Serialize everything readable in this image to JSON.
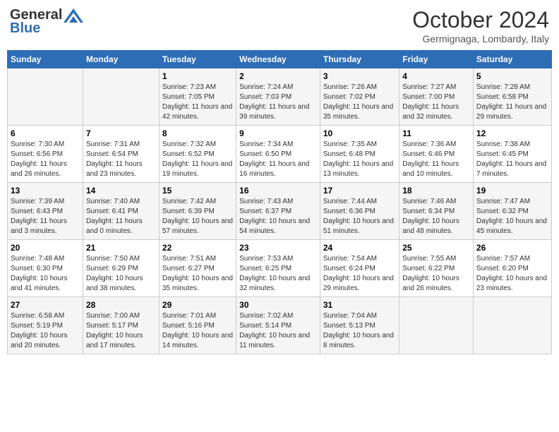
{
  "header": {
    "logo_line1": "General",
    "logo_line2": "Blue",
    "month": "October 2024",
    "location": "Germignaga, Lombardy, Italy"
  },
  "days_of_week": [
    "Sunday",
    "Monday",
    "Tuesday",
    "Wednesday",
    "Thursday",
    "Friday",
    "Saturday"
  ],
  "weeks": [
    [
      {
        "day": "",
        "info": ""
      },
      {
        "day": "",
        "info": ""
      },
      {
        "day": "1",
        "info": "Sunrise: 7:23 AM\nSunset: 7:05 PM\nDaylight: 11 hours and 42 minutes."
      },
      {
        "day": "2",
        "info": "Sunrise: 7:24 AM\nSunset: 7:03 PM\nDaylight: 11 hours and 39 minutes."
      },
      {
        "day": "3",
        "info": "Sunrise: 7:26 AM\nSunset: 7:02 PM\nDaylight: 11 hours and 35 minutes."
      },
      {
        "day": "4",
        "info": "Sunrise: 7:27 AM\nSunset: 7:00 PM\nDaylight: 11 hours and 32 minutes."
      },
      {
        "day": "5",
        "info": "Sunrise: 7:28 AM\nSunset: 6:58 PM\nDaylight: 11 hours and 29 minutes."
      }
    ],
    [
      {
        "day": "6",
        "info": "Sunrise: 7:30 AM\nSunset: 6:56 PM\nDaylight: 11 hours and 26 minutes."
      },
      {
        "day": "7",
        "info": "Sunrise: 7:31 AM\nSunset: 6:54 PM\nDaylight: 11 hours and 23 minutes."
      },
      {
        "day": "8",
        "info": "Sunrise: 7:32 AM\nSunset: 6:52 PM\nDaylight: 11 hours and 19 minutes."
      },
      {
        "day": "9",
        "info": "Sunrise: 7:34 AM\nSunset: 6:50 PM\nDaylight: 11 hours and 16 minutes."
      },
      {
        "day": "10",
        "info": "Sunrise: 7:35 AM\nSunset: 6:48 PM\nDaylight: 11 hours and 13 minutes."
      },
      {
        "day": "11",
        "info": "Sunrise: 7:36 AM\nSunset: 6:46 PM\nDaylight: 11 hours and 10 minutes."
      },
      {
        "day": "12",
        "info": "Sunrise: 7:38 AM\nSunset: 6:45 PM\nDaylight: 11 hours and 7 minutes."
      }
    ],
    [
      {
        "day": "13",
        "info": "Sunrise: 7:39 AM\nSunset: 6:43 PM\nDaylight: 11 hours and 3 minutes."
      },
      {
        "day": "14",
        "info": "Sunrise: 7:40 AM\nSunset: 6:41 PM\nDaylight: 11 hours and 0 minutes."
      },
      {
        "day": "15",
        "info": "Sunrise: 7:42 AM\nSunset: 6:39 PM\nDaylight: 10 hours and 57 minutes."
      },
      {
        "day": "16",
        "info": "Sunrise: 7:43 AM\nSunset: 6:37 PM\nDaylight: 10 hours and 54 minutes."
      },
      {
        "day": "17",
        "info": "Sunrise: 7:44 AM\nSunset: 6:36 PM\nDaylight: 10 hours and 51 minutes."
      },
      {
        "day": "18",
        "info": "Sunrise: 7:46 AM\nSunset: 6:34 PM\nDaylight: 10 hours and 48 minutes."
      },
      {
        "day": "19",
        "info": "Sunrise: 7:47 AM\nSunset: 6:32 PM\nDaylight: 10 hours and 45 minutes."
      }
    ],
    [
      {
        "day": "20",
        "info": "Sunrise: 7:48 AM\nSunset: 6:30 PM\nDaylight: 10 hours and 41 minutes."
      },
      {
        "day": "21",
        "info": "Sunrise: 7:50 AM\nSunset: 6:29 PM\nDaylight: 10 hours and 38 minutes."
      },
      {
        "day": "22",
        "info": "Sunrise: 7:51 AM\nSunset: 6:27 PM\nDaylight: 10 hours and 35 minutes."
      },
      {
        "day": "23",
        "info": "Sunrise: 7:53 AM\nSunset: 6:25 PM\nDaylight: 10 hours and 32 minutes."
      },
      {
        "day": "24",
        "info": "Sunrise: 7:54 AM\nSunset: 6:24 PM\nDaylight: 10 hours and 29 minutes."
      },
      {
        "day": "25",
        "info": "Sunrise: 7:55 AM\nSunset: 6:22 PM\nDaylight: 10 hours and 26 minutes."
      },
      {
        "day": "26",
        "info": "Sunrise: 7:57 AM\nSunset: 6:20 PM\nDaylight: 10 hours and 23 minutes."
      }
    ],
    [
      {
        "day": "27",
        "info": "Sunrise: 6:58 AM\nSunset: 5:19 PM\nDaylight: 10 hours and 20 minutes."
      },
      {
        "day": "28",
        "info": "Sunrise: 7:00 AM\nSunset: 5:17 PM\nDaylight: 10 hours and 17 minutes."
      },
      {
        "day": "29",
        "info": "Sunrise: 7:01 AM\nSunset: 5:16 PM\nDaylight: 10 hours and 14 minutes."
      },
      {
        "day": "30",
        "info": "Sunrise: 7:02 AM\nSunset: 5:14 PM\nDaylight: 10 hours and 11 minutes."
      },
      {
        "day": "31",
        "info": "Sunrise: 7:04 AM\nSunset: 5:13 PM\nDaylight: 10 hours and 8 minutes."
      },
      {
        "day": "",
        "info": ""
      },
      {
        "day": "",
        "info": ""
      }
    ]
  ]
}
